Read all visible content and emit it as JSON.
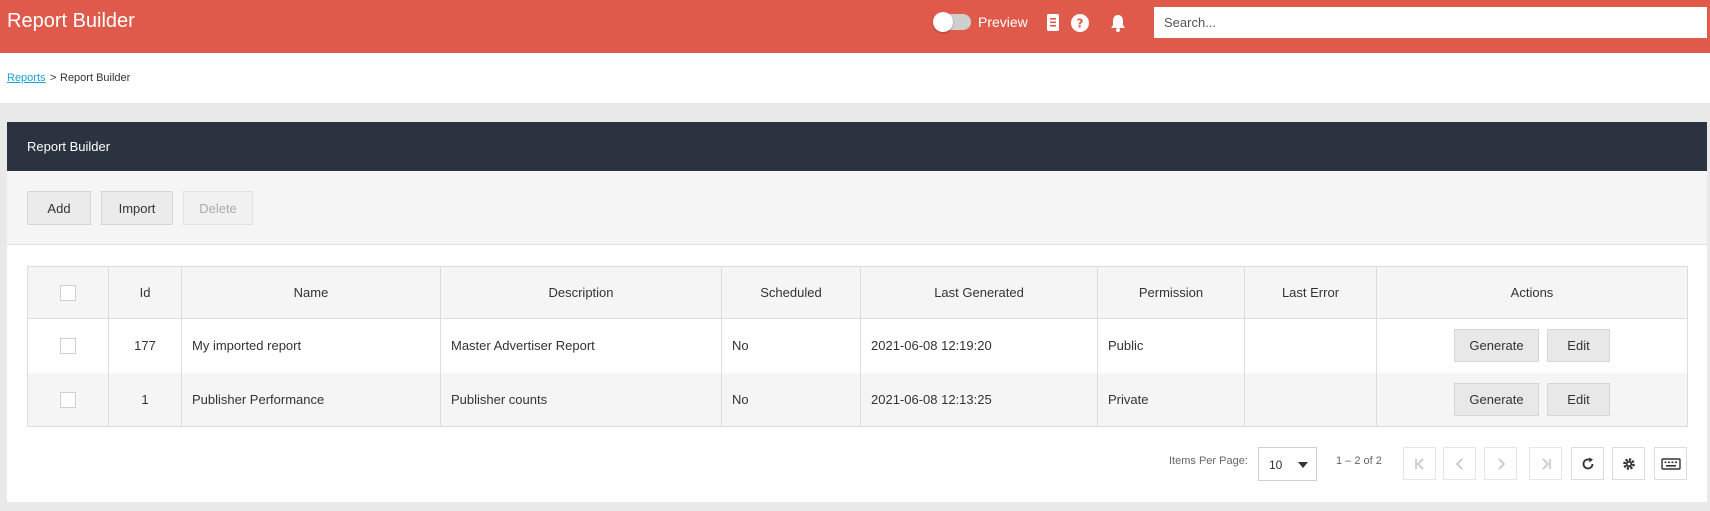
{
  "header": {
    "title": "Report Builder",
    "preview_label": "Preview",
    "preview_on": false,
    "search_placeholder": "Search..."
  },
  "breadcrumb": {
    "link": "Reports",
    "separator": ">",
    "current": "Report Builder"
  },
  "panel": {
    "title": "Report Builder",
    "toolbar": {
      "add": "Add",
      "import": "Import",
      "delete": "Delete"
    }
  },
  "table": {
    "columns": [
      "Id",
      "Name",
      "Description",
      "Scheduled",
      "Last Generated",
      "Permission",
      "Last Error",
      "Actions"
    ],
    "rows": [
      {
        "id": "177",
        "name": "My imported report",
        "description": "Master Advertiser Report",
        "scheduled": "No",
        "last_generated": "2021-06-08 12:19:20",
        "permission": "Public",
        "last_error": "",
        "generate": "Generate",
        "edit": "Edit"
      },
      {
        "id": "1",
        "name": "Publisher Performance",
        "description": "Publisher counts",
        "scheduled": "No",
        "last_generated": "2021-06-08 12:13:25",
        "permission": "Private",
        "last_error": "",
        "generate": "Generate",
        "edit": "Edit"
      }
    ]
  },
  "pager": {
    "items_per_page_label": "Items Per Page:",
    "items_per_page": "10",
    "range": "1 – 2 of 2"
  },
  "colors": {
    "header_bg": "#e05a4c",
    "panel_head_bg": "#2b3340",
    "link": "#1aa0d6"
  }
}
